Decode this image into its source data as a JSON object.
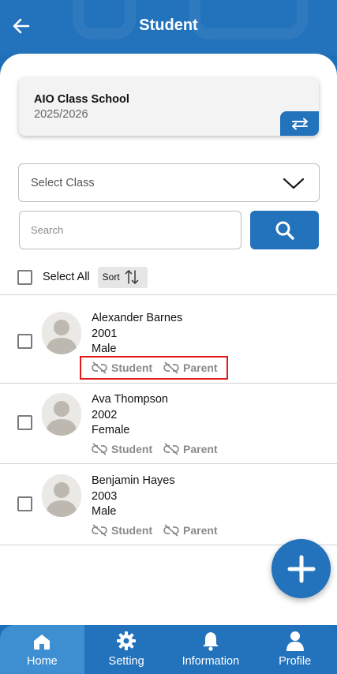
{
  "header": {
    "title": "Student"
  },
  "school": {
    "name": "AIO Class School",
    "year": "2025/2026"
  },
  "filters": {
    "select_class_label": "Select Class",
    "search_placeholder": "Search",
    "select_all_label": "Select All",
    "sort_label": "Sort"
  },
  "students": [
    {
      "name": "Alexander Barnes",
      "year": "2001",
      "gender": "Male",
      "student_link": "Student",
      "parent_link": "Parent"
    },
    {
      "name": "Ava Thompson",
      "year": "2002",
      "gender": "Female",
      "student_link": "Student",
      "parent_link": "Parent"
    },
    {
      "name": "Benjamin Hayes",
      "year": "2003",
      "gender": "Male",
      "student_link": "Student",
      "parent_link": "Parent"
    }
  ],
  "nav": {
    "items": [
      {
        "label": "Home",
        "icon": "home-icon"
      },
      {
        "label": "Setting",
        "icon": "gear-icon"
      },
      {
        "label": "Information",
        "icon": "bell-icon"
      },
      {
        "label": "Profile",
        "icon": "person-icon"
      }
    ]
  },
  "colors": {
    "primary": "#2272bc",
    "active_tab": "#3d8fd1",
    "highlight": "#e01a1a"
  }
}
